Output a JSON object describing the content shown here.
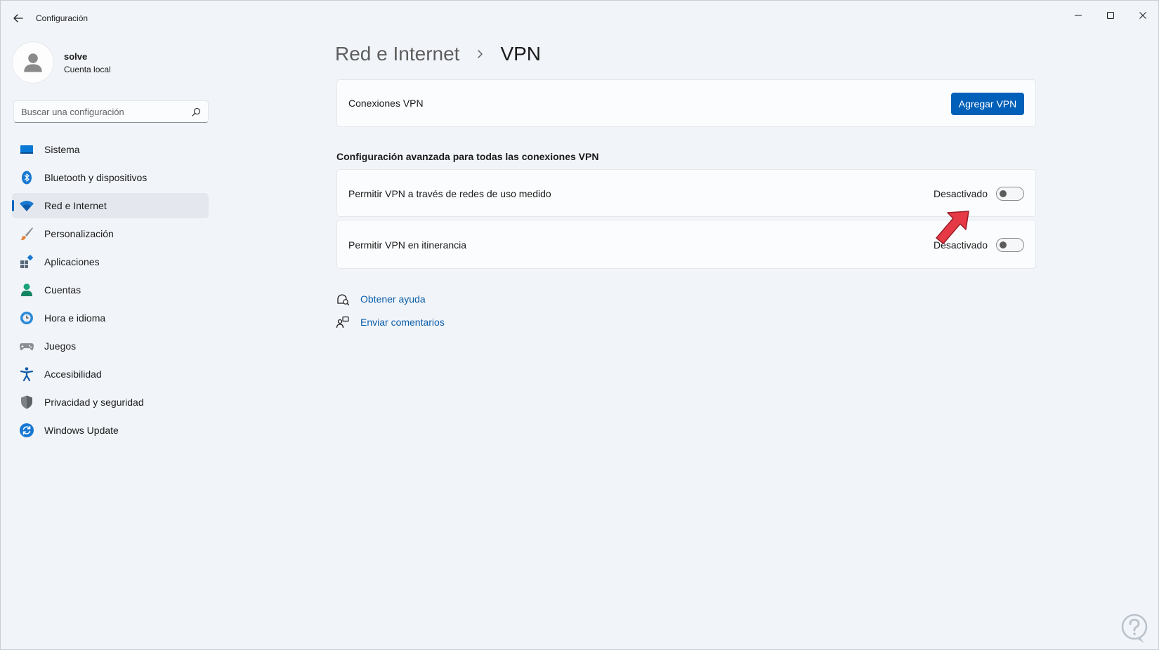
{
  "window": {
    "title": "Configuración"
  },
  "profile": {
    "name": "solve",
    "account_type": "Cuenta local"
  },
  "search": {
    "placeholder": "Buscar una configuración"
  },
  "sidebar": {
    "items": [
      {
        "label": "Sistema",
        "icon": "monitor-icon"
      },
      {
        "label": "Bluetooth y dispositivos",
        "icon": "bluetooth-icon"
      },
      {
        "label": "Red e Internet",
        "icon": "wifi-icon",
        "selected": true
      },
      {
        "label": "Personalización",
        "icon": "brush-icon"
      },
      {
        "label": "Aplicaciones",
        "icon": "apps-icon"
      },
      {
        "label": "Cuentas",
        "icon": "person-icon"
      },
      {
        "label": "Hora e idioma",
        "icon": "globe-clock-icon"
      },
      {
        "label": "Juegos",
        "icon": "gamepad-icon"
      },
      {
        "label": "Accesibilidad",
        "icon": "accessibility-icon"
      },
      {
        "label": "Privacidad y seguridad",
        "icon": "shield-icon"
      },
      {
        "label": "Windows Update",
        "icon": "refresh-icon"
      }
    ]
  },
  "breadcrumb": {
    "parent": "Red e Internet",
    "current": "VPN"
  },
  "vpn_connections": {
    "label": "Conexiones VPN",
    "add_button": "Agregar VPN"
  },
  "advanced": {
    "title": "Configuración avanzada para todas las conexiones VPN",
    "settings": [
      {
        "label": "Permitir VPN a través de redes de uso medido",
        "state": "Desactivado",
        "on": false
      },
      {
        "label": "Permitir VPN en itinerancia",
        "state": "Desactivado",
        "on": false
      }
    ]
  },
  "links": {
    "help": "Obtener ayuda",
    "feedback": "Enviar comentarios"
  },
  "colors": {
    "accent": "#005fb8",
    "selected_indicator": "#0067c0",
    "annotation_arrow": "#e63946"
  }
}
